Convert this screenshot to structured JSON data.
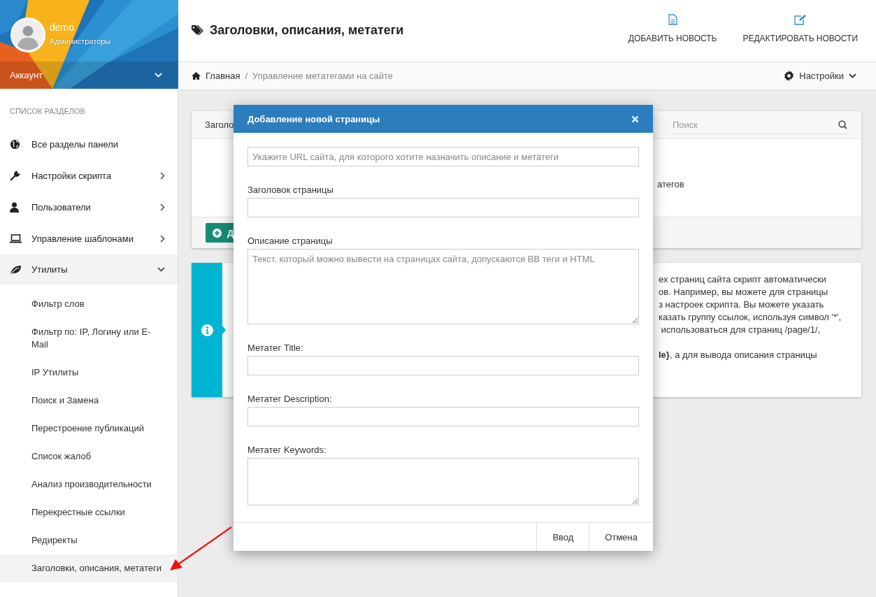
{
  "sidebar": {
    "user": {
      "name": "demo",
      "role": "Администраторы"
    },
    "account": {
      "label": "Аккаунт",
      "expanded": false
    },
    "section_title": "СПИСОК РАЗДЕЛОВ",
    "items": [
      {
        "label": "Все разделы панели"
      },
      {
        "label": "Настройки скрипта",
        "expanded": false
      },
      {
        "label": "Пользователи",
        "expanded": false
      },
      {
        "label": "Управление шаблонами",
        "expanded": false
      },
      {
        "label": "Утилиты",
        "expanded": true,
        "children": [
          {
            "label": "Фильтр слов",
            "selected": false
          },
          {
            "label": "Фильтр по: IP, Логину или E-Mail",
            "selected": false
          },
          {
            "label": "IP Утилиты",
            "selected": false
          },
          {
            "label": "Поиск и Замена",
            "selected": false
          },
          {
            "label": "Перестроение публикаций",
            "selected": false
          },
          {
            "label": "Список жалоб",
            "selected": false
          },
          {
            "label": "Анализ производительности",
            "selected": false
          },
          {
            "label": "Перекрестные ссылки",
            "selected": false
          },
          {
            "label": "Редиректы",
            "selected": false
          },
          {
            "label": "Заголовки, описания, метатеги",
            "selected": true
          }
        ]
      }
    ]
  },
  "header": {
    "title": "Заголовки, описания, метатеги",
    "actions": [
      {
        "label": "ДОБАВИТЬ НОВОСТЬ",
        "kind": "add"
      },
      {
        "label": "РЕДАКТИРОВАТЬ НОВОСТИ",
        "kind": "edit"
      }
    ]
  },
  "breadcrumb": {
    "items": [
      "Главная",
      "Управление метатегами на сайте"
    ],
    "separator": "/",
    "settings": "Настройки"
  },
  "panel": {
    "column_1": "Заголо",
    "search": {
      "placeholder": "Поиск"
    },
    "body_text": "атегов",
    "add_button": "Д"
  },
  "info": {
    "lines": [
      "ех страниц сайта скрипт автоматически",
      "ов. Например, вы можете для страницы",
      "з настроек скрипта. Вы можете указать",
      "казать группу ссылок, используя символ '*',",
      " использоваться для страниц /page/1/,"
    ],
    "note": "**le}**, а для вывода описания страницы"
  },
  "modal": {
    "title": "Добавление новой страницы",
    "fields": [
      {
        "kind": "input",
        "placeholder": "Укажите URL сайта, для которого хотите назначить описание и метатеги"
      },
      {
        "kind": "input",
        "label": "Заголовок страницы"
      },
      {
        "kind": "textarea",
        "label": "Описание страницы",
        "placeholder": "Текст, который можно вывести на страницах сайта, допускаются BB теги и HTML"
      },
      {
        "kind": "input",
        "label": "Метатег Title:"
      },
      {
        "kind": "input",
        "label": "Метатег Description:"
      },
      {
        "kind": "textarea",
        "label": "Метатег Keywords:",
        "small": true
      }
    ],
    "buttons": [
      "Ввод",
      "Отмена"
    ]
  }
}
